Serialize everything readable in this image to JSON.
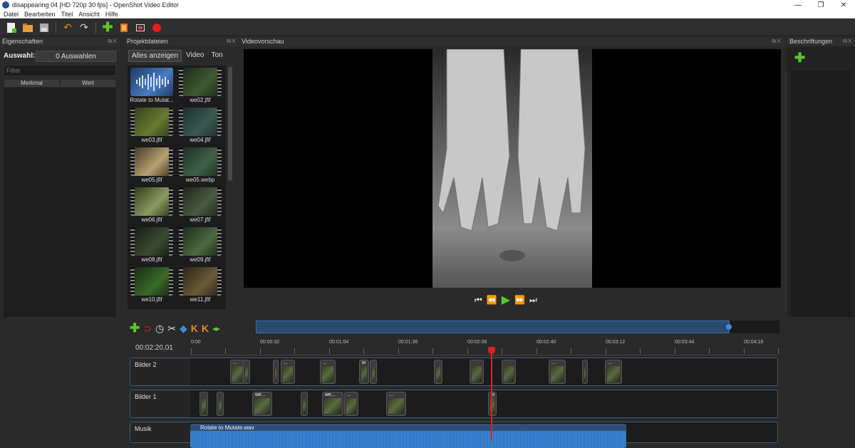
{
  "window": {
    "title": "disappearing 04 [HD 720p 30 fps] - OpenShot Video Editor",
    "controls": [
      "—",
      "❐",
      "✕"
    ]
  },
  "menu": [
    "Datei",
    "Bearbeiten",
    "Titel",
    "Ansicht",
    "Hilfe"
  ],
  "toolbar": {
    "icons": [
      "new-project-icon",
      "open-project-icon",
      "save-project-icon",
      "undo-icon",
      "redo-icon",
      "import-files-icon",
      "profile-icon",
      "fullscreen-icon",
      "record-icon"
    ]
  },
  "properties": {
    "title": "Eigenschaften",
    "selection_label": "Auswahl:",
    "selection_button": "0 Auswahlen",
    "filter_placeholder": "Filter",
    "columns": [
      "Merkmal",
      "Wert"
    ]
  },
  "project_files": {
    "title": "Projektdateien",
    "tabs": [
      "Alles anzeigen",
      "Video",
      "Ton"
    ],
    "items": [
      "Rotate to Mutat...",
      "we02.jfif",
      "we03.jfif",
      "we04.jfif",
      "we05.jfif",
      "we05.webp",
      "we06.jfif",
      "we07.jfif",
      "we08.jfif",
      "we09.jfif",
      "we10.jfif",
      "we11.jfif"
    ]
  },
  "video_preview": {
    "title": "Videovorschau",
    "controls": [
      "⏮",
      "⏪",
      "▶",
      "⏩",
      "⏭"
    ]
  },
  "captions": {
    "title": "Beschriftungen"
  },
  "timeline": {
    "timecode": "00:02:20,01",
    "ruler": [
      "0:00",
      "00:00:32",
      "00:01:04",
      "00:01:36",
      "00:02:08",
      "00:02:40",
      "00:03:12",
      "00:03:44",
      "00:04:16"
    ],
    "tracks": [
      {
        "name": "Bilder 2"
      },
      {
        "name": "Bilder 1"
      },
      {
        "name": "Musik"
      }
    ],
    "clip_labels": {
      "b2_1": "...",
      "b2_2": "...",
      "b2_3": "...",
      "b2_4": "w",
      "b2_5": "...",
      "b2_6": "...",
      "b1_1": "we...",
      "b1_2": "we...",
      "b1_3": "...",
      "b1_4": "...",
      "b1_5": "w",
      "audio": "Rotate to Mutate.wav"
    },
    "playhead_color": "#e02020",
    "accent": "#3d8bd9"
  }
}
